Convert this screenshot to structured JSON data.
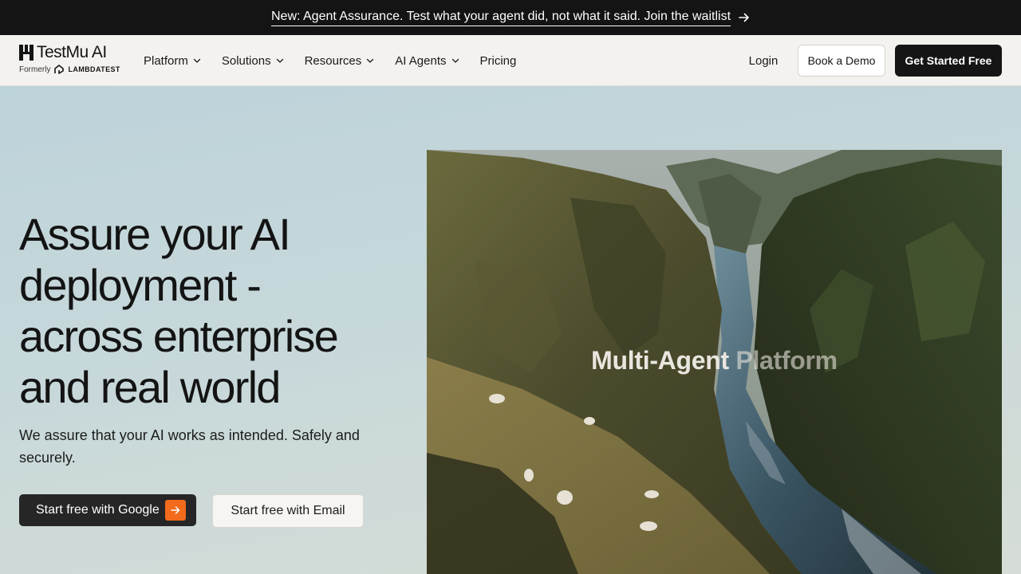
{
  "announcement": {
    "text": "New: Agent Assurance. Test what your agent did, not what it said. Join the waitlist",
    "arrow_icon": "arrow-right-icon"
  },
  "logo": {
    "name": "TestMu AI",
    "formerly": "Formerly",
    "former_brand": "LAMBDATEST"
  },
  "nav": {
    "items": [
      {
        "label": "Platform",
        "has_dropdown": true
      },
      {
        "label": "Solutions",
        "has_dropdown": true
      },
      {
        "label": "Resources",
        "has_dropdown": true
      },
      {
        "label": "AI Agents",
        "has_dropdown": true
      },
      {
        "label": "Pricing",
        "has_dropdown": false
      }
    ],
    "login": "Login",
    "book_demo": "Book a Demo",
    "get_started": "Get Started Free"
  },
  "hero": {
    "title_lines": [
      "Assure your AI",
      "deployment -",
      "across enterprise",
      "and real world"
    ],
    "subtitle": "We assure that your AI works as intended. Safely and securely.",
    "google_button": "Start free with Google",
    "email_button": "Start free with Email",
    "image_overlay": {
      "part1": "Multi-Agent",
      "part2": "Platform"
    }
  },
  "colors": {
    "announcement_bg": "#141414",
    "nav_bg": "#f4f2ee",
    "primary_button": "#151515",
    "accent_orange": "#f26a1b",
    "hero_bg": "#c4d6dc"
  }
}
